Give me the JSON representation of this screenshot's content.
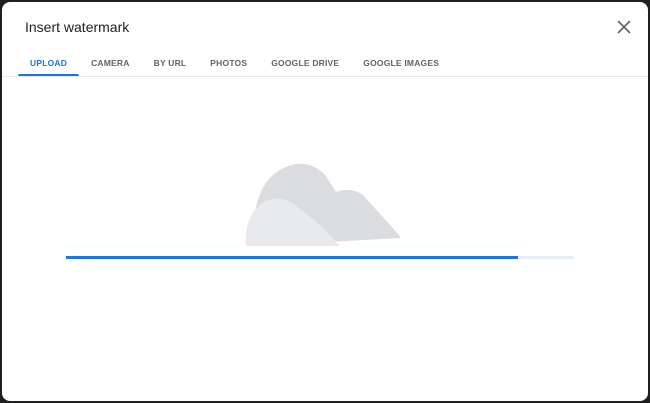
{
  "dialog": {
    "title": "Insert watermark",
    "close_icon": "close-icon"
  },
  "tabs": [
    {
      "label": "UPLOAD",
      "active": true
    },
    {
      "label": "CAMERA",
      "active": false
    },
    {
      "label": "BY URL",
      "active": false
    },
    {
      "label": "PHOTOS",
      "active": false
    },
    {
      "label": "GOOGLE DRIVE",
      "active": false
    },
    {
      "label": "GOOGLE IMAGES",
      "active": false
    }
  ],
  "upload": {
    "illustration_icon": "cloud-illustration-icon",
    "progress": 0.89
  },
  "colors": {
    "accent": "#1a73e8",
    "text": "#202124",
    "tab_inactive": "#5f6368",
    "cloud_back": "#dadce0",
    "cloud_front": "#e8eaed"
  }
}
